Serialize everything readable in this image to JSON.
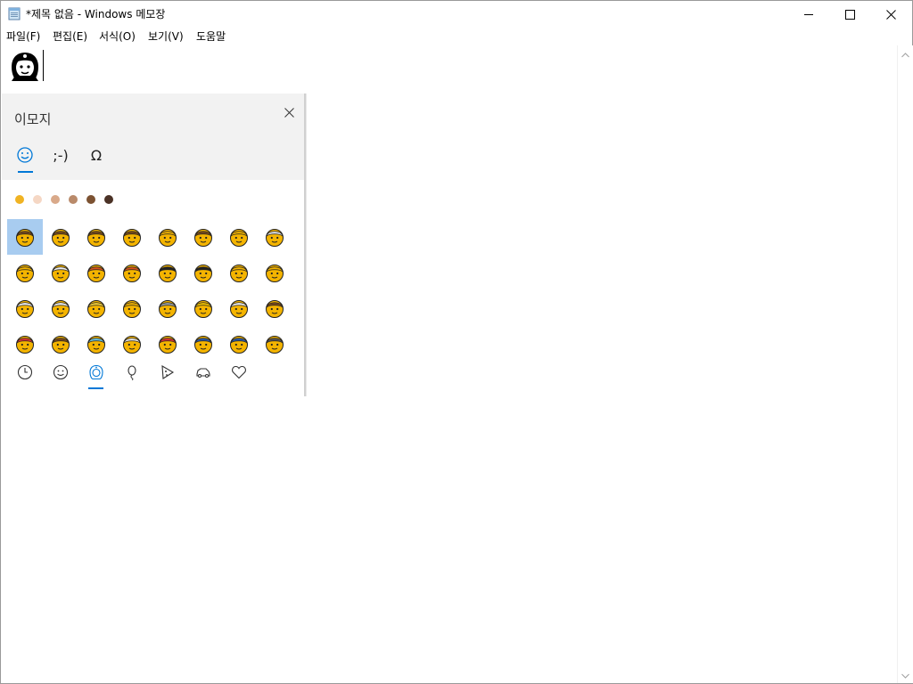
{
  "window": {
    "title": "*제목 없음 - Windows 메모장",
    "icon": "notepad-icon",
    "controls": [
      "minimize-icon",
      "maximize-icon",
      "close-icon"
    ]
  },
  "menu": {
    "items": [
      "파일(F)",
      "편집(E)",
      "서식(O)",
      "보기(V)",
      "도움말"
    ]
  },
  "editor": {
    "content_emoji": "woman-with-headscarf",
    "content_emoji_style": "outline-black"
  },
  "emoji_panel": {
    "title": "이모지",
    "close_icon": "close-icon",
    "tabs": [
      {
        "name": "emoji",
        "label": "☺",
        "selected": true
      },
      {
        "name": "kaomoji",
        "label": ";-)",
        "selected": false
      },
      {
        "name": "symbols",
        "label": "Ω",
        "selected": false
      }
    ],
    "skin_tones": [
      "#f0b323",
      "#f5d7c4",
      "#d9a98a",
      "#b98a6a",
      "#7c5232",
      "#4b3226"
    ],
    "grid": [
      [
        "woman",
        "man",
        "boy",
        "girl",
        "person-blond",
        "man-blond",
        "baby",
        "old-woman"
      ],
      [
        "old-man",
        "old-man-white-hair",
        "woman-red-hair",
        "man-red-hair",
        "woman-curly-hair",
        "man-curly-hair",
        "person-bald",
        "man-bald"
      ],
      [
        "woman-white-hair",
        "man-white-hair",
        "woman-blonde",
        "man-blonde",
        "person-with-turban",
        "prince",
        "older-person",
        "man-beard"
      ],
      [
        "person-red-cap",
        "man-brown",
        "angel",
        "grandma-glasses",
        "santa",
        "police-woman",
        "police-man",
        "detective"
      ]
    ],
    "selected_index": [
      0,
      0
    ],
    "category_nav": [
      {
        "name": "recent-icon",
        "selected": false
      },
      {
        "name": "smiley-icon",
        "selected": false
      },
      {
        "name": "people-icon",
        "selected": true
      },
      {
        "name": "balloon-icon",
        "selected": false
      },
      {
        "name": "pizza-icon",
        "selected": false
      },
      {
        "name": "car-icon",
        "selected": false
      },
      {
        "name": "heart-icon",
        "selected": false
      }
    ]
  },
  "colors": {
    "accent": "#0078d7",
    "selection": "#a8ccf0",
    "emoji_yellow": "#f4b400"
  }
}
